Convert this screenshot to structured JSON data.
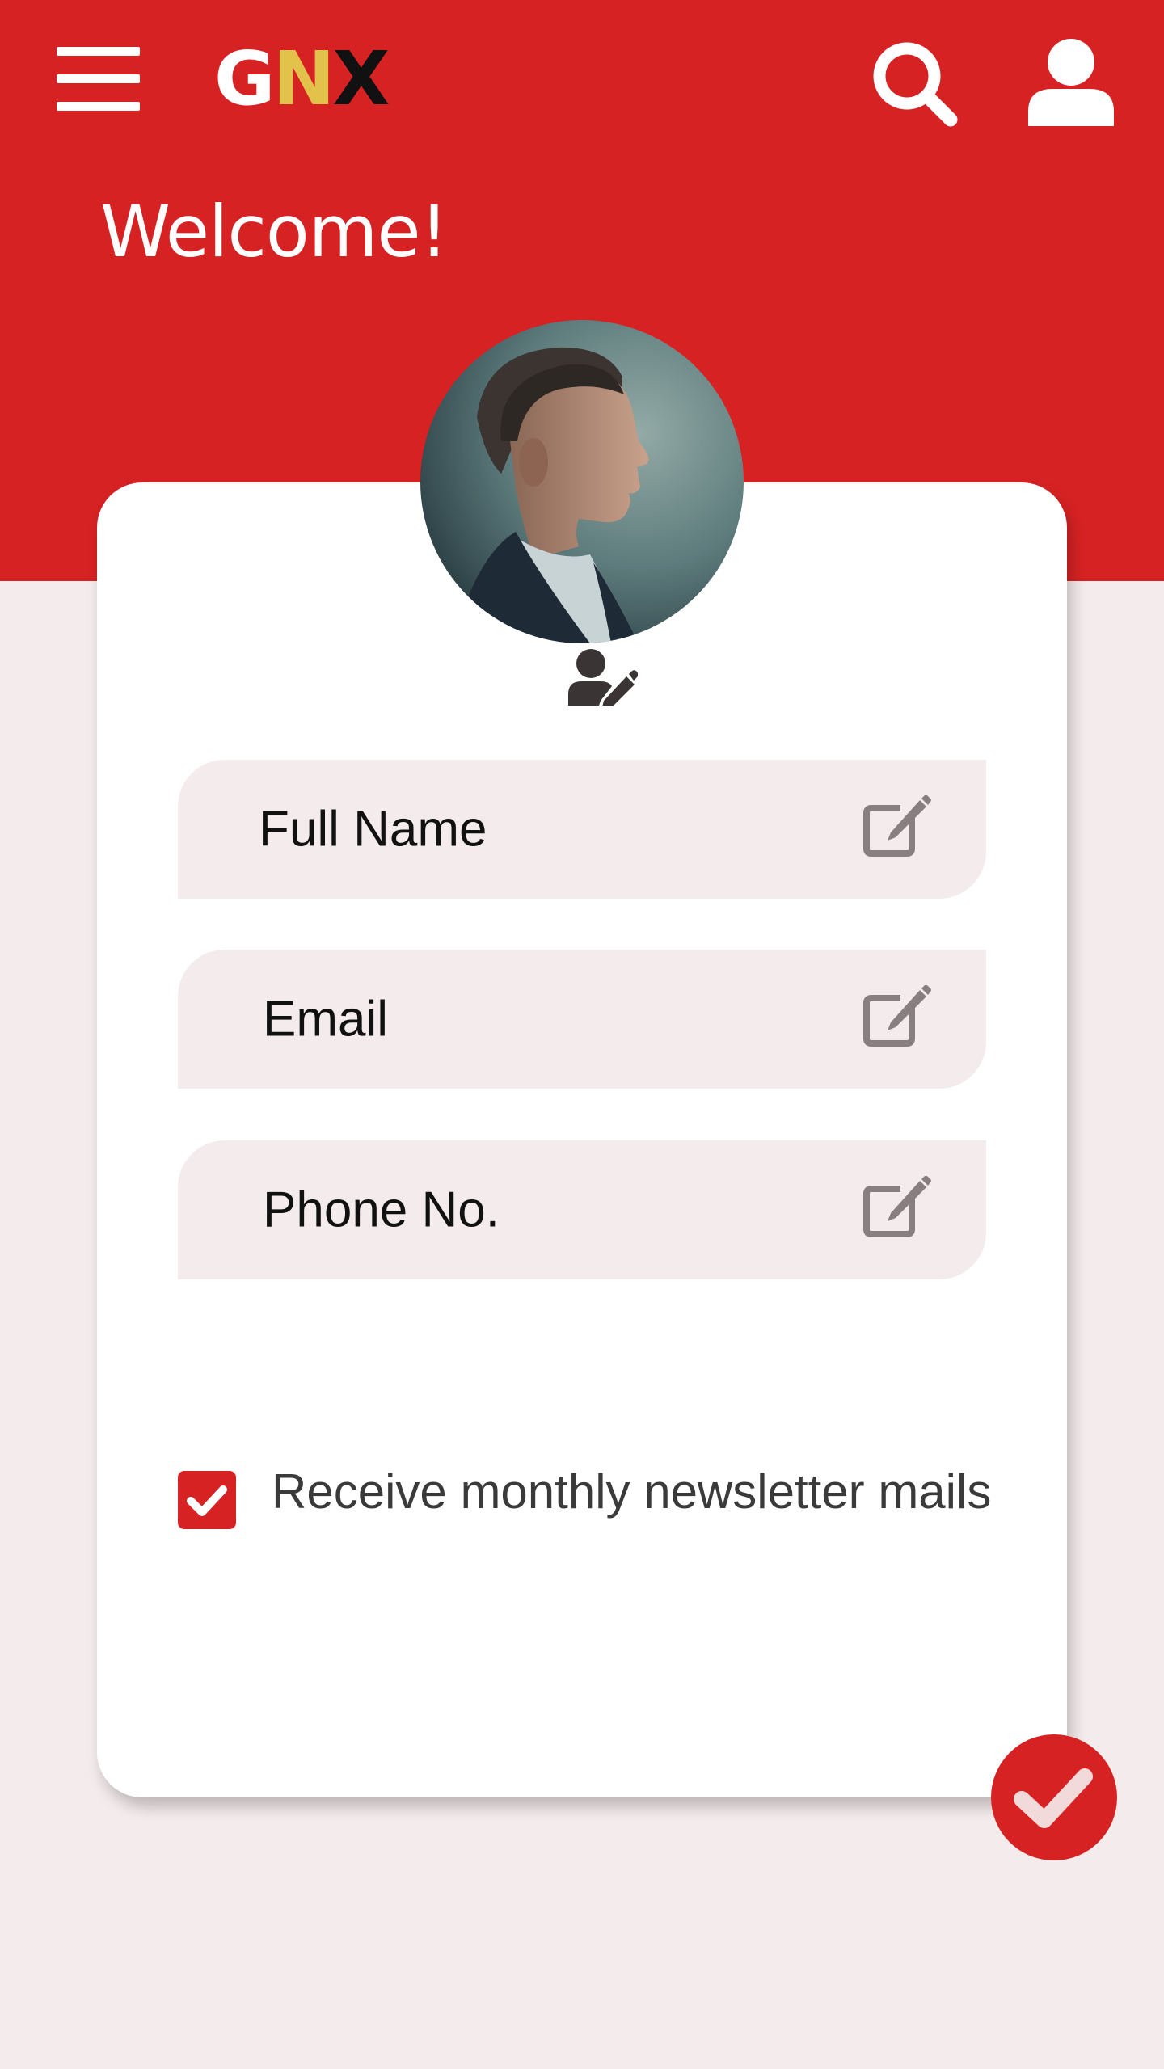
{
  "app": {
    "logo_letters": [
      {
        "char": "G",
        "color": "#FFFFFF"
      },
      {
        "char": "N",
        "color": "#E2C24A"
      },
      {
        "char": "X",
        "color": "#111111"
      }
    ]
  },
  "header": {
    "icons": [
      "menu-icon",
      "search-icon",
      "user-icon"
    ],
    "welcome": "Welcome!"
  },
  "profile": {
    "avatar_alt": "profile photo",
    "edit_photo_icon": "user-edit-icon"
  },
  "form": {
    "fields": [
      {
        "label": "Full Name",
        "icon": "edit-icon"
      },
      {
        "label": "Email",
        "icon": "edit-icon"
      },
      {
        "label": "Phone No.",
        "icon": "edit-icon"
      }
    ],
    "newsletter": {
      "label": "Receive monthly newsletter mails",
      "checked": true
    }
  },
  "actions": {
    "confirm_icon": "check-icon"
  },
  "colors": {
    "primary": "#D72224",
    "background": "#F4ECEC",
    "card": "#FFFFFF",
    "field": "#F4ECEC",
    "icon_gray": "#8A7F80"
  }
}
